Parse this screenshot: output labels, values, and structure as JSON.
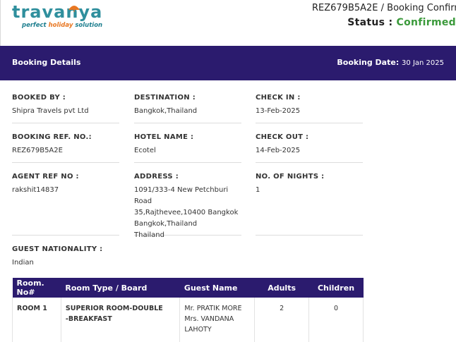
{
  "brand": {
    "name": "travanya",
    "tagline_pre": "perfect ",
    "tagline_hl": "holiday",
    "tagline_post": " solution",
    "color": "#2f8f9d",
    "accent": "#e87722"
  },
  "header": {
    "ref_title": "REZ679B5A2E  /  Booking Confirm",
    "status_label": "Status : ",
    "status_value": "Confirmed",
    "status_color": "#3b9a3b"
  },
  "bar": {
    "title": "Booking Details",
    "date_label": "Booking Date: ",
    "date_value": "30 Jan 2025",
    "color": "#2b1b6e"
  },
  "fields": {
    "booked_by": {
      "label": "BOOKED BY :",
      "value": "Shipra Travels pvt Ltd"
    },
    "destination": {
      "label": "DESTINATION :",
      "value": "Bangkok,Thailand"
    },
    "check_in": {
      "label": "CHECK IN :",
      "value": "13-Feb-2025"
    },
    "booking_ref": {
      "label": "BOOKING REF. NO.:",
      "value": "REZ679B5A2E"
    },
    "hotel_name": {
      "label": "HOTEL NAME :",
      "value": "Ecotel"
    },
    "check_out": {
      "label": "CHECK OUT :",
      "value": "14-Feb-2025"
    },
    "agent_ref": {
      "label": "AGENT REF NO :",
      "value": "rakshit14837"
    },
    "address": {
      "label": "ADDRESS :",
      "line1": "1091/333-4 New Petchburi Road",
      "line2": "35,Rajthevee,10400 Bangkok",
      "line3": "Bangkok,Thailand",
      "line4": "Thailand"
    },
    "nights": {
      "label": "NO. OF NIGHTS :",
      "value": "1"
    },
    "nationality": {
      "label": "GUEST NATIONALITY :",
      "value": "Indian"
    }
  },
  "rooms_table": {
    "headers": [
      "Room. No#",
      "Room Type / Board",
      "Guest Name",
      "Adults",
      "Children"
    ],
    "rows": [
      {
        "room_no": "ROOM 1",
        "type_line1": "SUPERIOR ROOM-DOUBLE",
        "type_line2": "-BREAKFAST",
        "guest_line1": "Mr. PRATIK MORE",
        "guest_line2": "Mrs. VANDANA",
        "guest_line3": "LAHOTY",
        "adults": "2",
        "children": "0"
      }
    ]
  }
}
